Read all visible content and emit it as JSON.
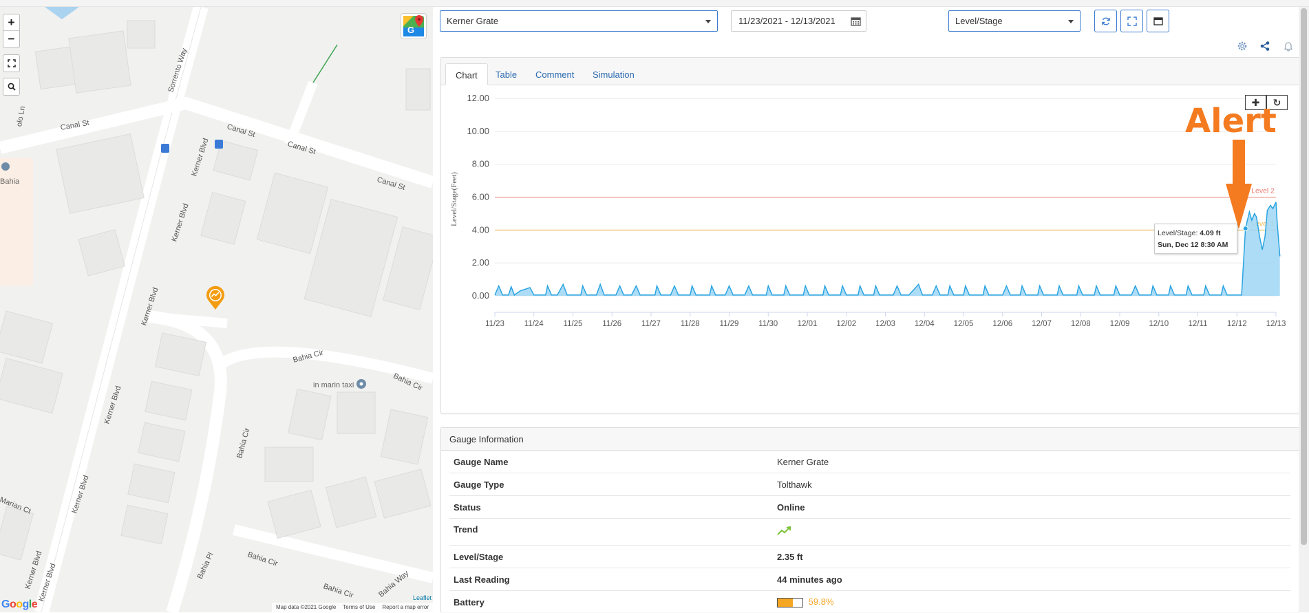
{
  "map": {
    "zoom_in": "+",
    "zoom_out": "−",
    "streets": {
      "canal1": "Canal St",
      "canal2": "Canal St",
      "canal3": "Canal St",
      "canal4": "Canal St",
      "sorrento": "Sorrento Way",
      "kerner1": "Kerner Blvd",
      "kerner2": "Kerner Blvd",
      "kerner3": "Kerner Blvd",
      "kerner4": "Kerner Blvd",
      "kerner5": "Kerner Blvd",
      "kerner6": "Kerner Blvd",
      "kerner7": "Kerner Blvd",
      "kerner8": "Kerner Blvd",
      "bahiacir1": "Bahia Cir",
      "bahiacir2": "Bahia Cir",
      "bahiacir3": "Bahia Cir",
      "bahiacir4": "Bahia Cir",
      "bahiacir5": "Bahia Cir",
      "bahiapl": "Bahia Pl",
      "bahiaway": "Bahia Way",
      "marian": "Marian Ct",
      "olo": "olo Ln"
    },
    "poi_bahia": "Bahia",
    "poi_taxi": "in marin taxi",
    "google": "Google",
    "leaflet": "Leaflet",
    "footer": [
      "Map data ©2021 Google",
      "Terms of Use",
      "Report a map error"
    ]
  },
  "toolbar": {
    "gauge_select": "Kerner Grate",
    "date_range": "11/23/2021 - 12/13/2021",
    "metric_select": "Level/Stage"
  },
  "tabs": [
    "Chart",
    "Table",
    "Comment",
    "Simulation"
  ],
  "chart_data": {
    "type": "area",
    "ylabel": "Level/Stage(Feet)",
    "ylim": [
      0,
      12
    ],
    "yticks": [
      "12.00",
      "10.00",
      "8.00",
      "6.00",
      "4.00",
      "2.00",
      "0.00"
    ],
    "xticks": [
      "11/23",
      "11/24",
      "11/25",
      "11/26",
      "11/27",
      "11/28",
      "11/29",
      "11/30",
      "12/01",
      "12/02",
      "12/03",
      "12/04",
      "12/05",
      "12/06",
      "12/07",
      "12/08",
      "12/09",
      "12/10",
      "12/11",
      "12/12",
      "12/13"
    ],
    "thresholds": [
      {
        "name": "Level 2",
        "value": 6.0,
        "color": "#e8796f"
      },
      {
        "name": "Level 1",
        "value": 4.0,
        "color": "#e6b84a"
      }
    ],
    "series_color": "#2aa4e0",
    "series_fill": "#9fd6f5",
    "series": [
      {
        "values": [
          [
            0.0,
            0.05
          ],
          [
            0.1,
            0.6
          ],
          [
            0.2,
            0.05
          ],
          [
            0.35,
            0.05
          ],
          [
            0.42,
            0.55
          ],
          [
            0.5,
            0.05
          ],
          [
            0.65,
            0.3
          ],
          [
            0.9,
            0.5
          ],
          [
            1.0,
            0.05
          ],
          [
            1.1,
            0.05
          ],
          [
            1.3,
            0.05
          ],
          [
            1.35,
            0.6
          ],
          [
            1.45,
            0.05
          ],
          [
            1.6,
            0.05
          ],
          [
            1.75,
            0.7
          ],
          [
            1.85,
            0.05
          ],
          [
            2.0,
            0.05
          ],
          [
            2.2,
            0.05
          ],
          [
            2.25,
            0.6
          ],
          [
            2.35,
            0.05
          ],
          [
            2.6,
            0.05
          ],
          [
            2.7,
            0.7
          ],
          [
            2.8,
            0.05
          ],
          [
            3.1,
            0.05
          ],
          [
            3.2,
            0.6
          ],
          [
            3.3,
            0.05
          ],
          [
            3.5,
            0.05
          ],
          [
            3.62,
            0.6
          ],
          [
            3.72,
            0.05
          ],
          [
            4.1,
            0.05
          ],
          [
            4.15,
            0.6
          ],
          [
            4.25,
            0.05
          ],
          [
            4.5,
            0.05
          ],
          [
            4.6,
            0.6
          ],
          [
            4.7,
            0.05
          ],
          [
            5.0,
            0.05
          ],
          [
            5.05,
            0.6
          ],
          [
            5.15,
            0.05
          ],
          [
            5.5,
            0.05
          ],
          [
            5.55,
            0.6
          ],
          [
            5.65,
            0.05
          ],
          [
            5.9,
            0.05
          ],
          [
            6.0,
            0.6
          ],
          [
            6.1,
            0.05
          ],
          [
            6.4,
            0.05
          ],
          [
            6.5,
            0.6
          ],
          [
            6.6,
            0.05
          ],
          [
            6.95,
            0.05
          ],
          [
            7.0,
            0.6
          ],
          [
            7.1,
            0.05
          ],
          [
            7.4,
            0.05
          ],
          [
            7.45,
            0.6
          ],
          [
            7.55,
            0.05
          ],
          [
            7.9,
            0.05
          ],
          [
            7.95,
            0.6
          ],
          [
            8.05,
            0.05
          ],
          [
            8.4,
            0.05
          ],
          [
            8.45,
            0.6
          ],
          [
            8.55,
            0.05
          ],
          [
            8.85,
            0.05
          ],
          [
            8.9,
            0.6
          ],
          [
            9.0,
            0.05
          ],
          [
            9.3,
            0.05
          ],
          [
            9.35,
            0.6
          ],
          [
            9.45,
            0.05
          ],
          [
            9.7,
            0.05
          ],
          [
            9.75,
            0.6
          ],
          [
            9.85,
            0.05
          ],
          [
            10.2,
            0.05
          ],
          [
            10.3,
            0.6
          ],
          [
            10.4,
            0.05
          ],
          [
            10.6,
            0.05
          ],
          [
            10.7,
            0.3
          ],
          [
            10.85,
            0.7
          ],
          [
            10.95,
            0.05
          ],
          [
            11.2,
            0.05
          ],
          [
            11.3,
            0.6
          ],
          [
            11.4,
            0.05
          ],
          [
            11.6,
            0.05
          ],
          [
            11.65,
            0.6
          ],
          [
            11.75,
            0.05
          ],
          [
            12.0,
            0.05
          ],
          [
            12.05,
            0.6
          ],
          [
            12.15,
            0.05
          ],
          [
            12.5,
            0.05
          ],
          [
            12.55,
            0.6
          ],
          [
            12.65,
            0.05
          ],
          [
            13.0,
            0.05
          ],
          [
            13.1,
            0.6
          ],
          [
            13.2,
            0.05
          ],
          [
            13.45,
            0.05
          ],
          [
            13.5,
            0.6
          ],
          [
            13.6,
            0.05
          ],
          [
            13.9,
            0.05
          ],
          [
            13.95,
            0.6
          ],
          [
            14.05,
            0.05
          ],
          [
            14.4,
            0.05
          ],
          [
            14.45,
            0.6
          ],
          [
            14.55,
            0.05
          ],
          [
            14.9,
            0.05
          ],
          [
            14.95,
            0.6
          ],
          [
            15.05,
            0.05
          ],
          [
            15.35,
            0.05
          ],
          [
            15.4,
            0.6
          ],
          [
            15.5,
            0.05
          ],
          [
            15.85,
            0.05
          ],
          [
            15.9,
            0.6
          ],
          [
            16.0,
            0.05
          ],
          [
            16.3,
            0.05
          ],
          [
            16.4,
            0.6
          ],
          [
            16.5,
            0.05
          ],
          [
            16.8,
            0.05
          ],
          [
            16.85,
            0.6
          ],
          [
            16.95,
            0.05
          ],
          [
            17.25,
            0.05
          ],
          [
            17.3,
            0.6
          ],
          [
            17.4,
            0.05
          ],
          [
            17.7,
            0.05
          ],
          [
            17.75,
            0.6
          ],
          [
            17.85,
            0.05
          ],
          [
            18.15,
            0.05
          ],
          [
            18.2,
            0.6
          ],
          [
            18.3,
            0.05
          ],
          [
            18.6,
            0.05
          ],
          [
            18.65,
            0.6
          ],
          [
            18.75,
            0.05
          ],
          [
            19.0,
            0.05
          ],
          [
            19.12,
            0.05
          ],
          [
            19.22,
            4.1
          ],
          [
            19.32,
            5.1
          ],
          [
            19.38,
            4.6
          ],
          [
            19.45,
            5.0
          ],
          [
            19.5,
            4.8
          ],
          [
            19.58,
            3.6
          ],
          [
            19.65,
            2.8
          ],
          [
            19.72,
            3.6
          ],
          [
            19.78,
            5.2
          ],
          [
            19.86,
            5.5
          ],
          [
            19.92,
            5.3
          ],
          [
            20.0,
            5.7
          ],
          [
            20.03,
            4.5
          ],
          [
            20.1,
            2.4
          ]
        ]
      }
    ],
    "annotation": "Alert",
    "tooltip": {
      "label": "Level/Stage: ",
      "value": "4.09 ft",
      "date": "Sun, Dec 12 8:30 AM"
    }
  },
  "gauge_info": {
    "title": "Gauge Information",
    "rows": [
      {
        "key": "Gauge Name",
        "value": "Kerner Grate"
      },
      {
        "key": "Gauge Type",
        "value": "Tolthawk"
      },
      {
        "key": "Status",
        "value": "Online"
      },
      {
        "key": "Trend",
        "value": ""
      },
      {
        "key": "Level/Stage",
        "value": "2.35 ft"
      },
      {
        "key": "Last Reading",
        "value": "44 minutes ago"
      },
      {
        "key": "Battery",
        "value": "59.8%"
      }
    ],
    "battery_fraction": 0.598
  }
}
